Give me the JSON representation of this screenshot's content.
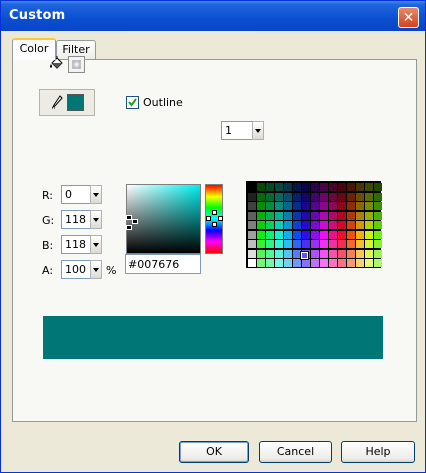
{
  "window": {
    "title": "Custom"
  },
  "tabs": [
    {
      "label": "Color"
    },
    {
      "label": "Filter"
    }
  ],
  "outline": {
    "checkbox_label": "Outline",
    "checked": true,
    "width_value": "1"
  },
  "rgb": {
    "r_label": "R:",
    "r_value": "0",
    "g_label": "G:",
    "g_value": "118",
    "b_label": "B:",
    "b_value": "118",
    "a_label": "A:",
    "a_value": "100",
    "a_unit": "%"
  },
  "hex_value": "#007676",
  "current_color": "#007676",
  "buttons": {
    "ok": "OK",
    "cancel": "Cancel",
    "help": "Help"
  },
  "icons": [
    "paint-bucket-icon",
    "fill-swatch-icon",
    "pen-icon",
    "outline-swatch-icon",
    "close-icon",
    "dropdown-arrow-icon"
  ]
}
